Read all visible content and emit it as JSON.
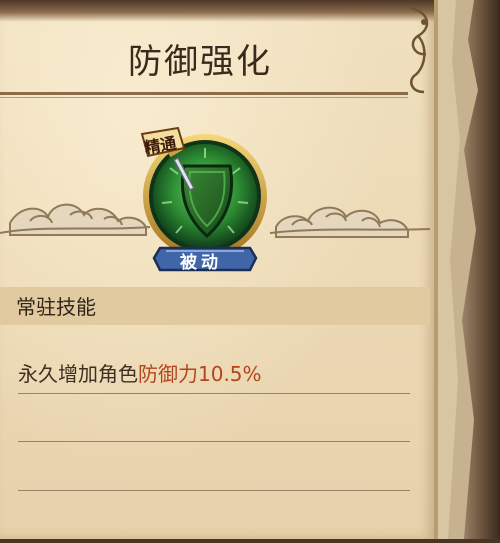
{
  "skill": {
    "title": "防御强化",
    "badge_top": "精通",
    "badge_bottom": "被动",
    "category": "常驻技能",
    "description_prefix": "永久增加角色",
    "description_highlight": "防御力",
    "description_value": "10.5%"
  },
  "colors": {
    "highlight": "#b5451b",
    "shield_green": "#2f7a2a",
    "badge_blue": "#3f66a8",
    "badge_red": "#8a2a1a"
  },
  "icons": {
    "skill_icon": "shield-sword-icon"
  }
}
